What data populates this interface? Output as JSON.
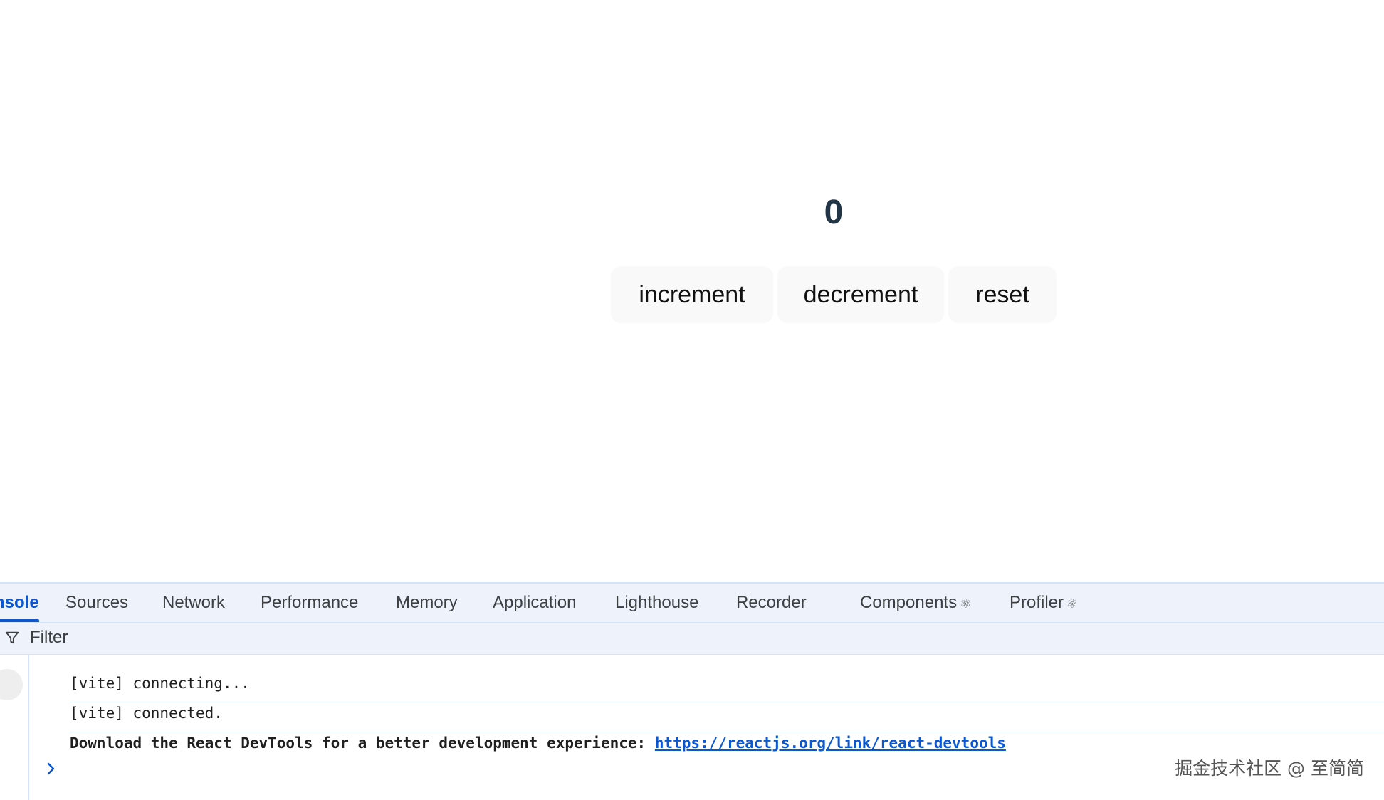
{
  "app": {
    "count": "0",
    "buttons": {
      "increment": "increment",
      "decrement": "decrement",
      "reset": "reset"
    }
  },
  "devtools": {
    "tabs": [
      {
        "label": "nsole",
        "active": true
      },
      {
        "label": "Sources"
      },
      {
        "label": "Network"
      },
      {
        "label": "Performance"
      },
      {
        "label": "Memory"
      },
      {
        "label": "Application"
      },
      {
        "label": "Lighthouse"
      },
      {
        "label": "Recorder"
      },
      {
        "label": "Components",
        "react_icon": "⚛"
      },
      {
        "label": "Profiler",
        "react_icon": "⚛"
      }
    ],
    "filter": {
      "placeholder": "Filter"
    },
    "console": {
      "messages": [
        {
          "text": "[vite] connecting..."
        },
        {
          "text": "[vite] connected."
        },
        {
          "text": "Download the React DevTools for a better development experience: ",
          "link": "https://reactjs.org/link/react-devtools"
        }
      ]
    }
  },
  "watermark": "掘金技术社区 @ 至简简",
  "colors": {
    "accent": "#0b57d0",
    "devtools_bg": "#eef3fb",
    "count_text": "#213547",
    "button_bg": "#f9f9f9"
  }
}
